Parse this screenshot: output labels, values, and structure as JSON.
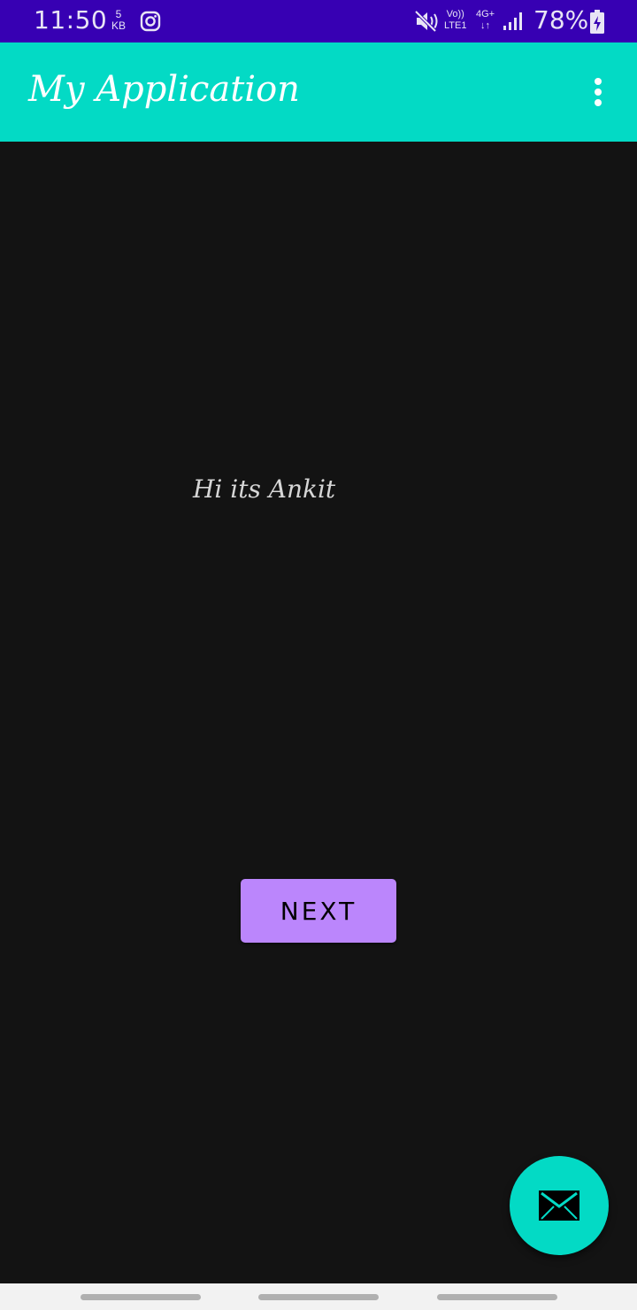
{
  "status_bar": {
    "time": "11:50",
    "data_speed_value": "5",
    "data_speed_unit": "KB",
    "volte_top": "Vo))",
    "volte_bottom": "LTE1",
    "network_type": "4G+",
    "network_arrows": "↓↑",
    "battery_percent": "78%",
    "icons": [
      "instagram-icon",
      "mute-icon",
      "signal-icon",
      "battery-charging-icon"
    ]
  },
  "app_bar": {
    "title": "My Application",
    "menu_icon": "more-vert-icon"
  },
  "main": {
    "greeting": "Hi its Ankit",
    "next_button_label": "NEXT"
  },
  "fab": {
    "icon": "mail-icon"
  },
  "colors": {
    "status_bar": "#3700b3",
    "app_bar": "#03dac5",
    "background": "#131313",
    "button": "#bb86fc",
    "fab": "#03dac5",
    "nav_bar": "#f2f2f2"
  }
}
